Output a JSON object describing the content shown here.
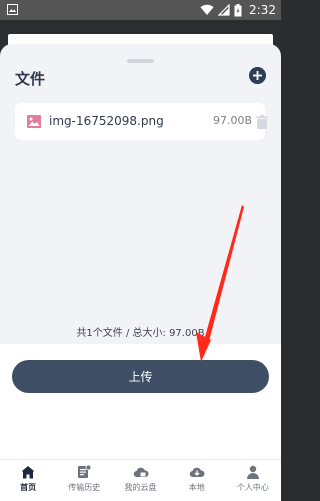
{
  "status_bar": {
    "time": "2:32"
  },
  "sheet": {
    "title": "文件",
    "files": [
      {
        "name": "img-16752098.png",
        "size": "97.00B"
      }
    ],
    "summary": "共1个文件 / 总大小: 97.00B"
  },
  "upload": {
    "label": "上传"
  },
  "bottom_nav": {
    "items": [
      {
        "label": "首页",
        "icon": "home-icon",
        "active": true
      },
      {
        "label": "传输历史",
        "icon": "transfer-history-icon"
      },
      {
        "label": "我的云盘",
        "icon": "cloud-drive-icon"
      },
      {
        "label": "本地",
        "icon": "local-download-icon"
      },
      {
        "label": "个人中心",
        "icon": "person-icon"
      }
    ]
  },
  "colors": {
    "primary": "#3e4f65",
    "dark": "#2e3f55",
    "image_icon": "#e27d97",
    "arrow": "#ff2a1a"
  }
}
